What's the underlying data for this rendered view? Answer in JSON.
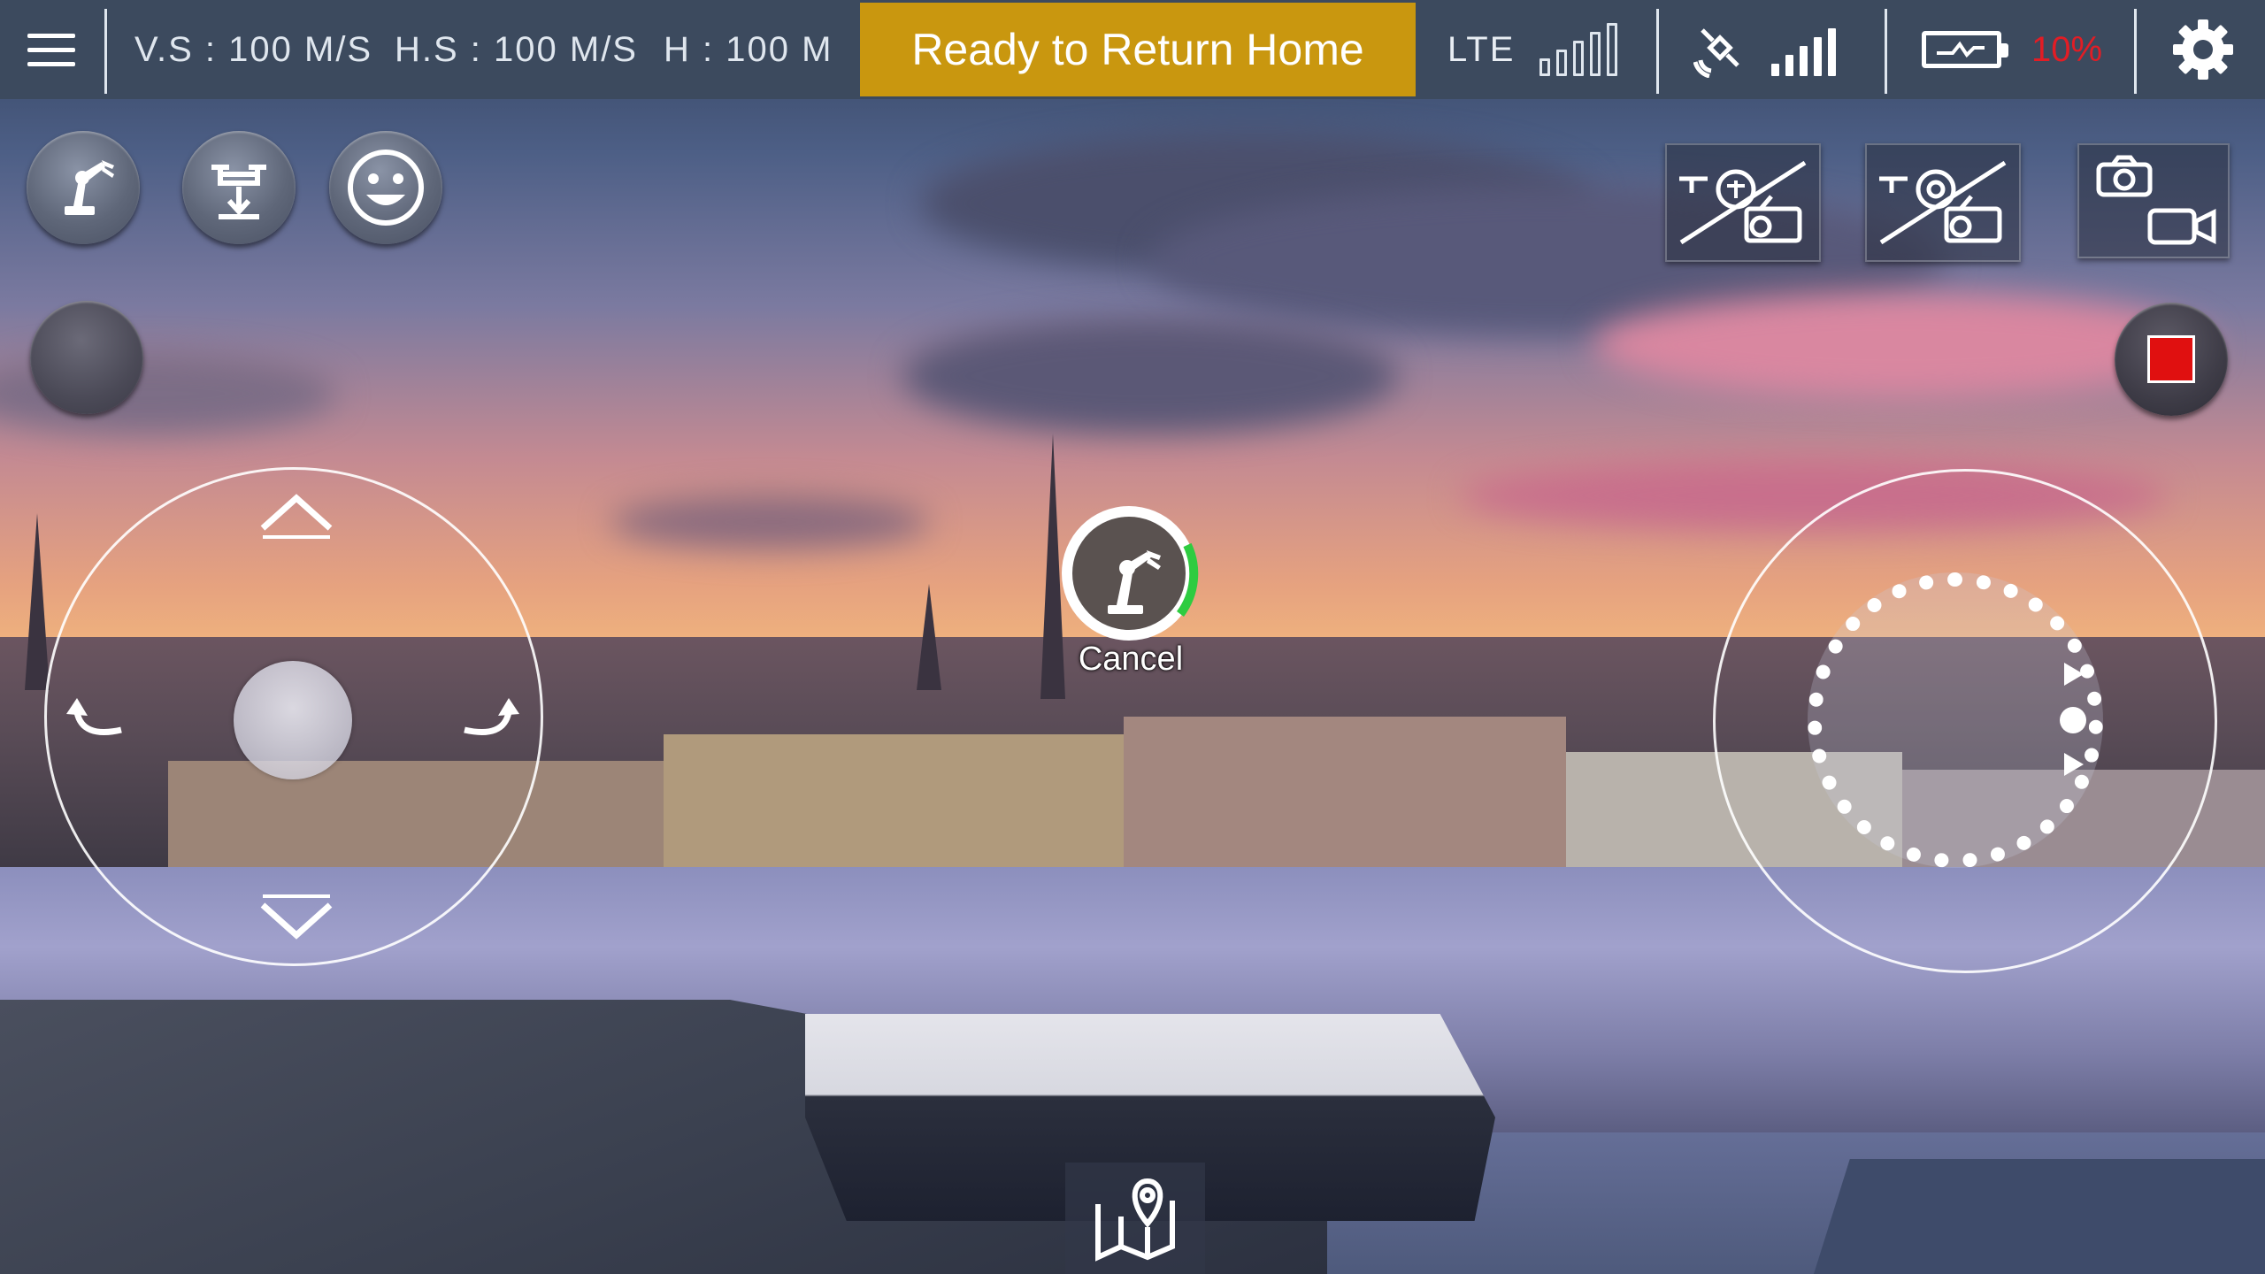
{
  "status_bar": {
    "vertical_speed": "V.S : 100 M/S",
    "horizontal_speed": "H.S : 100 M/S",
    "height": "H : 100 M",
    "banner": "Ready to Return Home",
    "network": "LTE",
    "battery_percent": "10%"
  },
  "center": {
    "cancel_label": "Cancel"
  },
  "colors": {
    "banner": "#c9970f",
    "battery_low": "#e21d25",
    "record": "#e01010",
    "progress": "#2ecc40"
  },
  "icons": [
    "menu-icon",
    "robot-arm-icon",
    "drone-land-icon",
    "smiley-icon",
    "lte-signal-icon",
    "satellite-icon",
    "gps-signal-icon",
    "battery-icon",
    "settings-icon",
    "drone-controller-swap-icon",
    "drone-camera-swap-icon",
    "camera-icon",
    "video-icon",
    "record-stop-icon",
    "map-icon"
  ],
  "left_joystick": {
    "up": "chevron-up",
    "down": "chevron-down",
    "left": "rotate-left",
    "right": "rotate-right"
  }
}
